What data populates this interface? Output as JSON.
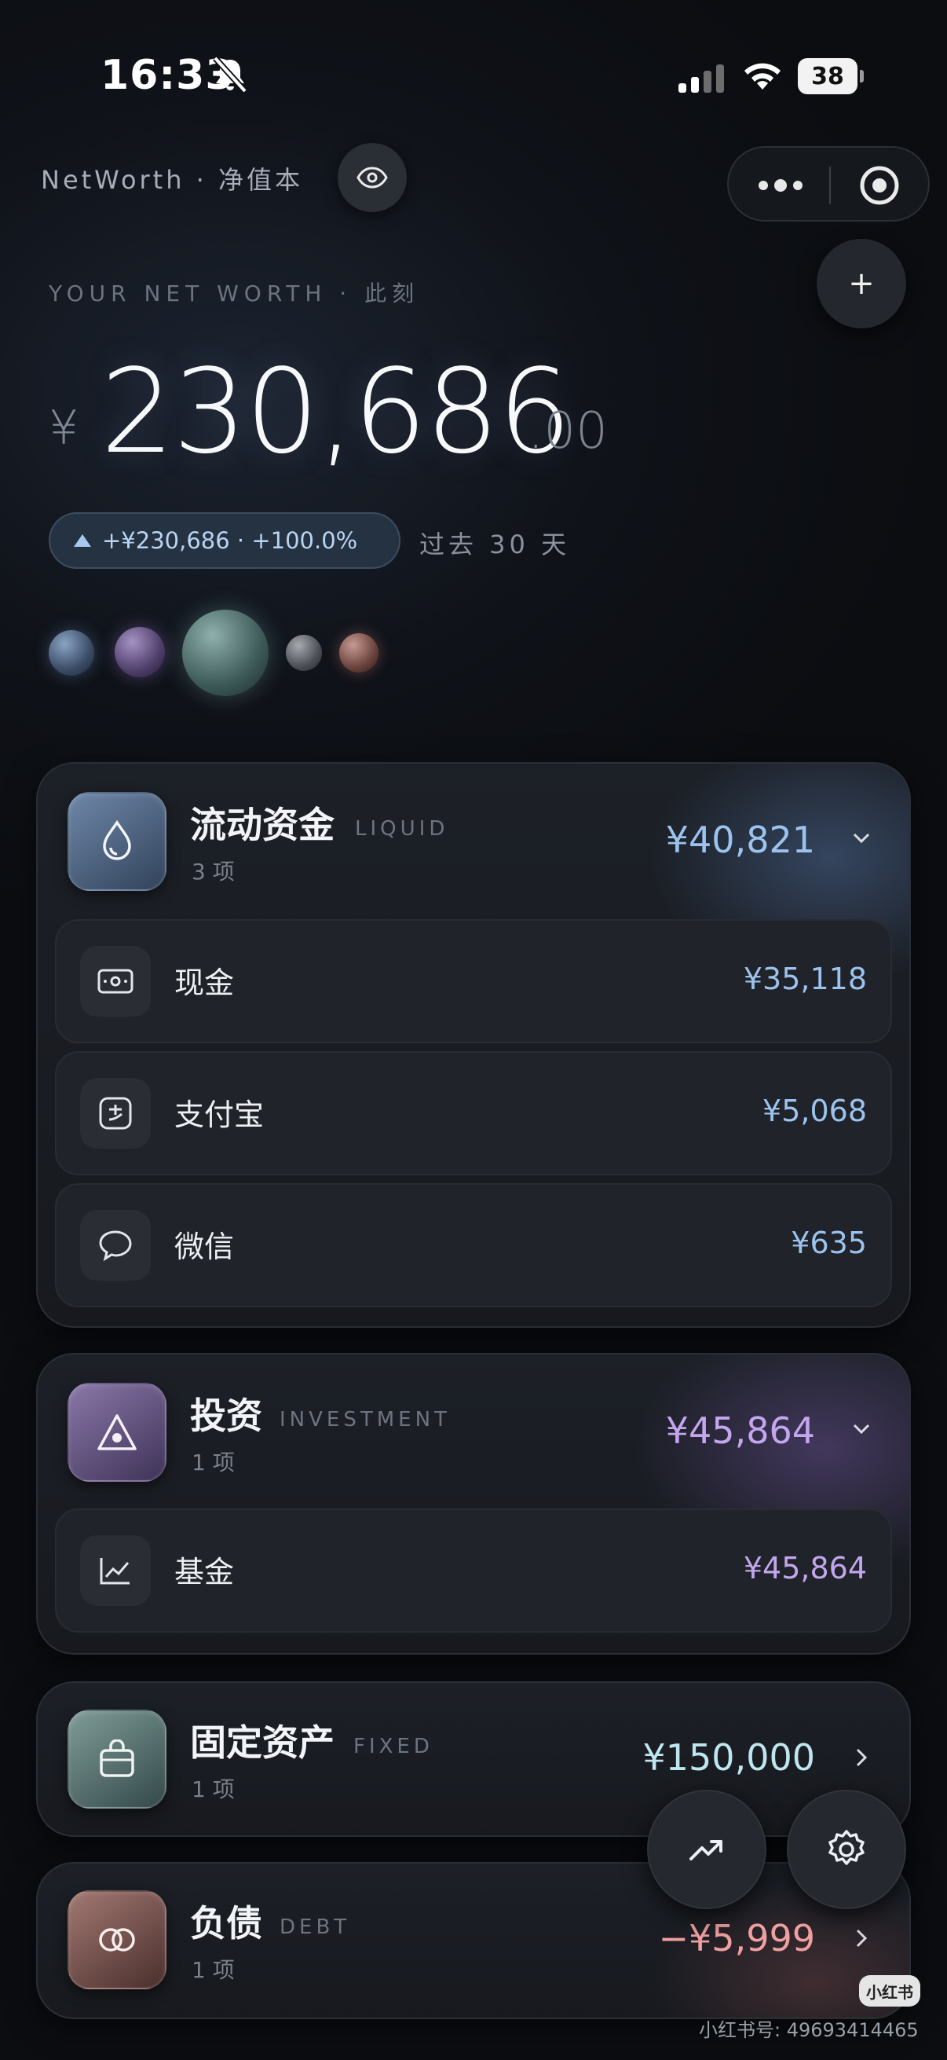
{
  "status_bar": {
    "time": "16:33",
    "battery": "38"
  },
  "header": {
    "app_title": "NetWorth · 净值本",
    "net_worth_label": "YOUR NET WORTH · 此刻",
    "currency_symbol": "¥",
    "amount_integer": "230,686",
    "amount_decimals": ".00",
    "change_text": "+¥230,686 · +100.0%",
    "change_period": "过去 30 天",
    "add_label": "+"
  },
  "categories": [
    {
      "title": "流动资金",
      "en": "LIQUID",
      "count": "3 项",
      "amount": "¥40,821",
      "items": [
        {
          "label": "现金",
          "amount": "¥35,118"
        },
        {
          "label": "支付宝",
          "amount": "¥5,068"
        },
        {
          "label": "微信",
          "amount": "¥635"
        }
      ]
    },
    {
      "title": "投资",
      "en": "INVESTMENT",
      "count": "1 项",
      "amount": "¥45,864",
      "items": [
        {
          "label": "基金",
          "amount": "¥45,864"
        }
      ]
    },
    {
      "title": "固定资产",
      "en": "FIXED",
      "count": "1 项",
      "amount": "¥150,000"
    },
    {
      "title": "负债",
      "en": "DEBT",
      "count": "1 项",
      "amount": "−¥5,999"
    }
  ],
  "watermark": {
    "badge": "小红书",
    "text": "小红书号: 49693414465"
  },
  "colors": {
    "liquid": "#9cc3ee",
    "investment": "#c3a6ee",
    "fixed": "#bfe6ee",
    "debt": "#f0a0a0"
  }
}
